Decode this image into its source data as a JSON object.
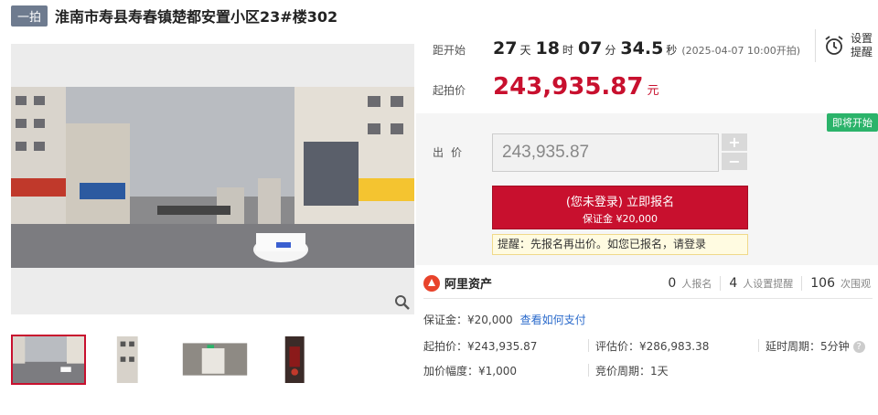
{
  "header": {
    "tag": "一拍",
    "title": "淮南市寿县寿春镇楚都安置小区23#楼302"
  },
  "countdown": {
    "label": "距开始",
    "days": "27",
    "days_unit": "天",
    "hours": "18",
    "hours_unit": "时",
    "minutes": "07",
    "minutes_unit": "分",
    "seconds": "34.5",
    "seconds_unit": "秒",
    "start_note": "(2025-04-07 10:00开拍)"
  },
  "start_price": {
    "label": "起拍价",
    "value": "243,935.87",
    "unit": "元"
  },
  "reminder": {
    "label": "设置提醒",
    "icon": "alarm-clock-icon"
  },
  "bid": {
    "status_badge": "即将开始",
    "label": "出价",
    "input_value": "243,935.87",
    "plus": "+",
    "minus": "−",
    "signup_main": "(您未登录) 立即报名",
    "signup_sub": "保证金 ¥20,000",
    "tip": "提醒：先报名再出价。如您已报名，请登录"
  },
  "platform": {
    "name": "阿里资产"
  },
  "stats": [
    {
      "num": "0",
      "label": "人报名"
    },
    {
      "num": "4",
      "label": "人设置提醒"
    },
    {
      "num": "106",
      "label": "次围观"
    }
  ],
  "details": {
    "deposit": "保证金：¥20,000",
    "deposit_link": "查看如何支付",
    "start_price": "起拍价：¥243,935.87",
    "appraisal": "评估价：¥286,983.38",
    "delay": "延时周期：5分钟",
    "increment": "加价幅度：¥1,000",
    "cycle": "竞价周期：1天"
  },
  "colors": {
    "accent": "#c8102e",
    "badge": "#2bb36a",
    "link": "#2a6acb"
  }
}
